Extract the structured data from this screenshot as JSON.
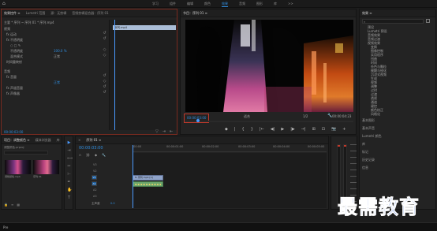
{
  "workspaces": [
    "学习",
    "组件",
    "编辑",
    "颜色",
    "效果",
    "音频",
    "图形",
    "库",
    ">>"
  ],
  "effect_controls": {
    "tabs": [
      "效果控件 ≡",
      "Lumetri 范围",
      "源：无剪辑",
      "音频剪辑混合器：序列 01"
    ],
    "breadcrumb": "主要 * 序列 ~ 序列 01 * 序列.mp4",
    "mini_clip": "序列.mp4",
    "rows": [
      "视频",
      "fx 运动",
      "fx 不透明度",
      "○ □ ✎",
      "不透明度",
      "混合模式",
      "时间重映射",
      "音频",
      "fx 音量",
      "fx 声道音量",
      "fx 声像器"
    ],
    "opacity_value": "100.0 %",
    "blend_value": "正常",
    "bypass_value": "正常",
    "time": "00:00:03:00"
  },
  "program_monitor": {
    "title": "节目：序列 01 ≡",
    "timecode": "00:00:03:00",
    "fit": "适合",
    "fraction": "1/2",
    "duration": "00:00:04:23",
    "transport": [
      "◆",
      "|",
      "{",
      "}",
      "|←",
      "◀|",
      "▶",
      "|▶",
      "→|",
      "⊞",
      "⊡",
      "📷",
      "+"
    ]
  },
  "project": {
    "tabs": [
      "项目：调整颜色 ≡",
      "媒体浏览器",
      "库",
      "信息",
      ">>"
    ],
    "filename": "调整颜色.prproj",
    "items": [
      {
        "name": "调整颜色.mp4",
        "duration": "4:23"
      },
      {
        "name": "序列 01",
        "duration": "4:23"
      }
    ]
  },
  "timeline": {
    "title": "序列 01 ≡",
    "timecode": "00:00:03:00",
    "ruler": [
      ":00:00",
      "00:00:01:00",
      "00:00:02:00",
      "00:00:03:00",
      "00:00:04:00",
      "00:00:05:00"
    ],
    "tracks": [
      "V3",
      "V2",
      "V1",
      "A1",
      "A2",
      "A3",
      "主声道"
    ],
    "master_value": "0.0",
    "video_clip": "fx 序列.mp4 [V]",
    "audio_clip": ""
  },
  "effects_panel": {
    "title": "效果 ≡",
    "search_placeholder": "",
    "tree": [
      "预设",
      "Lumetri 预设",
      "音频效果",
      "音频过渡",
      "视频效果",
      "变换",
      "图像控制",
      "实用程序",
      "扭曲",
      "时间",
      "杂色与颗粒",
      "模糊与锐化",
      "沉浸式视频",
      "生成",
      "视频",
      "调整",
      "过时",
      "过渡",
      "透视",
      "通道",
      "键控",
      "颜色校正",
      "风格化"
    ],
    "sections": [
      "基本图形",
      "基本声音",
      "Lumetri 颜色",
      "库",
      "标记",
      "历史记录",
      "信息"
    ]
  },
  "status": {
    "left": "Pre",
    "watermark": "最需教育"
  },
  "colors": {
    "accent": "#2f8ee0",
    "background": "#1d1d1d",
    "panel": "#232323",
    "clip_video": "#8fa3c8",
    "clip_audio": "#6aa56c",
    "playhead": "#4a9aff",
    "watermark": "#2a5fd8"
  }
}
